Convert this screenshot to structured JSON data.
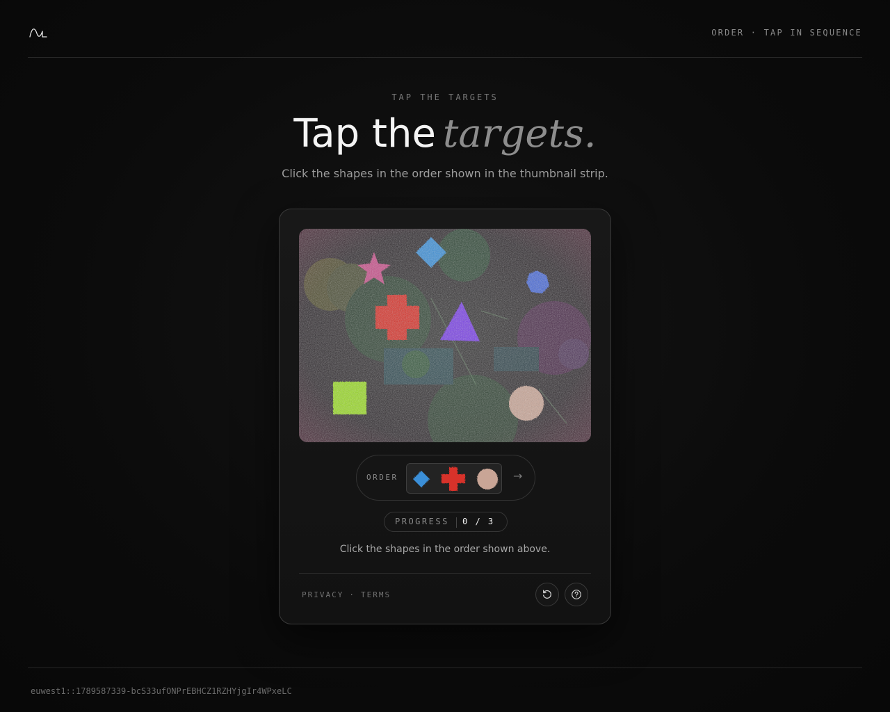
{
  "header": {
    "logo_icon": "wave-logo-icon",
    "tag": "ORDER · TAP IN SEQUENCE"
  },
  "hero": {
    "eyebrow": "TAP THE TARGETS",
    "title_plain": "Tap the",
    "title_emphasis": "targets.",
    "subtitle": "Click the shapes in the order shown in the thumbnail strip."
  },
  "challenge": {
    "order_label": "ORDER",
    "order_items": [
      {
        "shape": "diamond",
        "color": "#3a8fd8"
      },
      {
        "shape": "cross",
        "color": "#d8302a"
      },
      {
        "shape": "circle",
        "color": "#c9a596"
      }
    ],
    "next_icon": "arrow-right-icon",
    "progress_label": "PROGRESS",
    "progress_value": "0 / 3",
    "instruction": "Click the shapes in the order shown above."
  },
  "footer_links": {
    "privacy": "PRIVACY",
    "separator": "·",
    "terms": "TERMS"
  },
  "actions": {
    "refresh_icon": "refresh-icon",
    "help_icon": "help-icon"
  },
  "footer": {
    "session_id": "euwest1::1789587339-bcS33ufONPrEBHCZ1RZHYjgIr4WPxeLC"
  },
  "colors": {
    "background": "#0b0b0b",
    "card_border": "#3a3a3a",
    "text_primary": "#f4f4f4",
    "text_muted": "#8d8d8d"
  }
}
